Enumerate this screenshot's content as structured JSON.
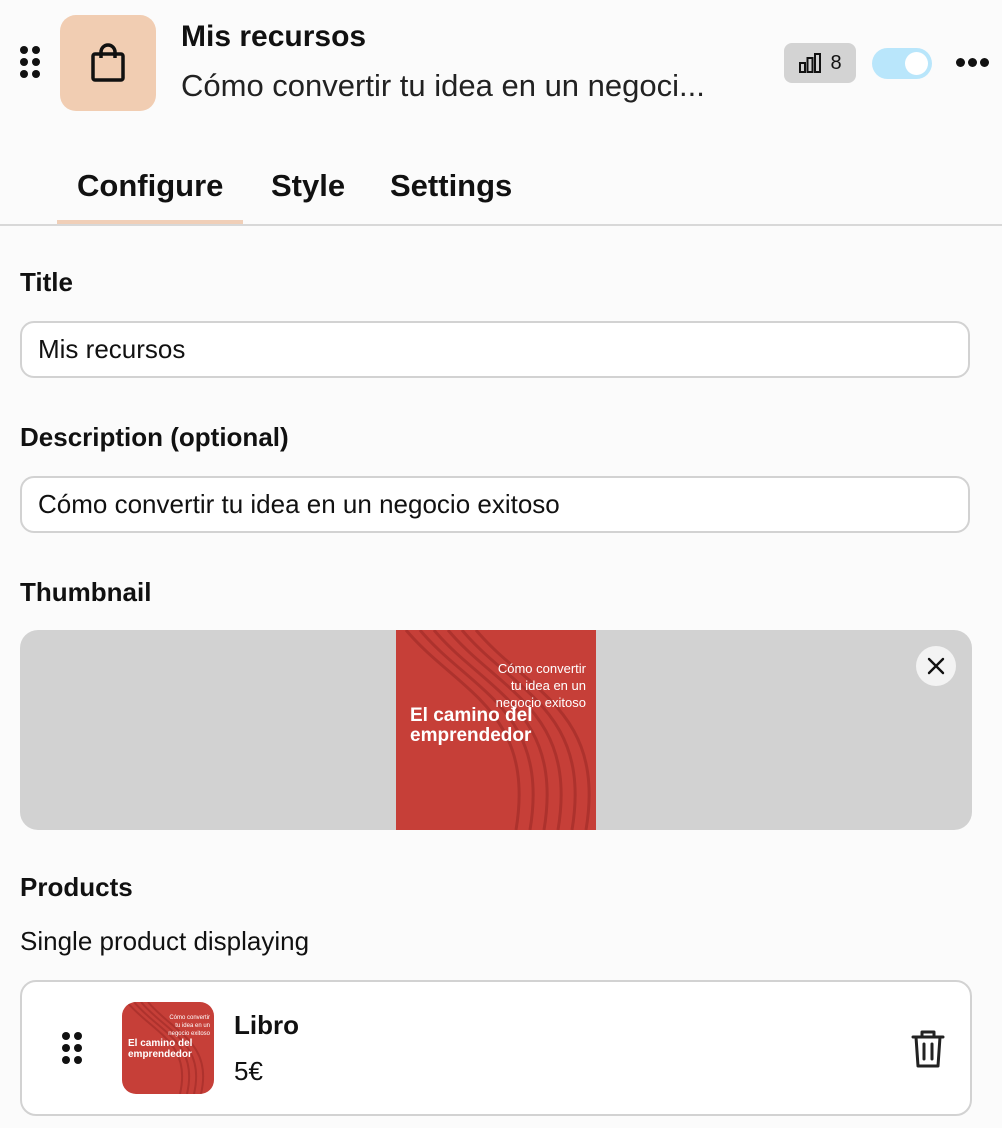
{
  "header": {
    "title": "Mis recursos",
    "subtitle": "Cómo convertir tu idea en un negoci...",
    "stats_count": "8",
    "enabled": true,
    "accent_tile_color": "#f1cdb2",
    "icon": "shopping-bag-icon"
  },
  "tabs": [
    {
      "label": "Configure",
      "active": true
    },
    {
      "label": "Style",
      "active": false
    },
    {
      "label": "Settings",
      "active": false
    }
  ],
  "form": {
    "title_label": "Title",
    "title_value": "Mis recursos",
    "description_label": "Description (optional)",
    "description_value": "Cómo convertir tu idea en un negocio exitoso",
    "thumbnail_label": "Thumbnail",
    "thumbnail": {
      "subtitle_lines": [
        "Cómo convertir",
        "tu idea en un",
        "negocio exitoso"
      ],
      "title_lines": [
        "El camino del",
        "emprendedor"
      ],
      "cover_color": "#c63f38"
    },
    "products_label": "Products",
    "products_helper": "Single product displaying",
    "products": [
      {
        "name": "Libro",
        "price": "5€",
        "thumb_subtitle_lines": [
          "Cómo convertir",
          "tu idea en un",
          "negocio exitoso"
        ],
        "thumb_title_lines": [
          "El camino del",
          "emprendedor"
        ]
      }
    ]
  }
}
